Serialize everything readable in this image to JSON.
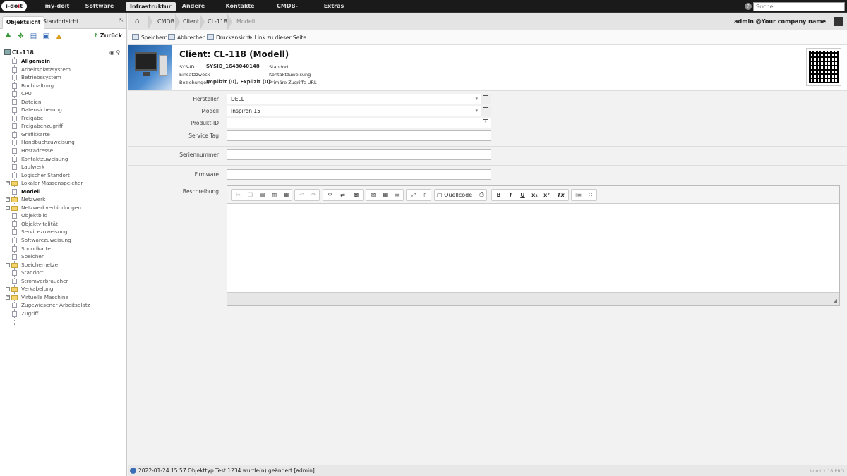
{
  "logo": {
    "text_a": "i-do",
    "text_b": "i",
    "text_c": "t"
  },
  "nav": [
    "my-doit",
    "Software",
    "Infrastruktur",
    "Andere",
    "Kontakte",
    "CMDB-Explorer",
    "Extras"
  ],
  "search": {
    "placeholder": "Suche..."
  },
  "left": {
    "tabs": [
      "Objektsicht",
      "Standortsicht"
    ],
    "back_label": "Zurück",
    "root": "CL-118",
    "tree": [
      {
        "label": "Allgemein",
        "bold": true,
        "type": "doc"
      },
      {
        "label": "Arbeitsplatzsystem",
        "type": "doc"
      },
      {
        "label": "Betriebssystem",
        "type": "doc"
      },
      {
        "label": "Buchhaltung",
        "type": "doc"
      },
      {
        "label": "CPU",
        "type": "doc"
      },
      {
        "label": "Dateien",
        "type": "doc"
      },
      {
        "label": "Datensicherung",
        "type": "doc"
      },
      {
        "label": "Freigabe",
        "type": "doc"
      },
      {
        "label": "Freigabenzugriff",
        "type": "doc"
      },
      {
        "label": "Grafikkarte",
        "type": "doc"
      },
      {
        "label": "Handbuchzuweisung",
        "type": "doc"
      },
      {
        "label": "Hostadresse",
        "type": "doc"
      },
      {
        "label": "Kontaktzuweisung",
        "type": "doc"
      },
      {
        "label": "Laufwerk",
        "type": "doc"
      },
      {
        "label": "Logischer Standort",
        "type": "doc"
      },
      {
        "label": "Lokaler Massenspeicher",
        "type": "folder"
      },
      {
        "label": "Modell",
        "bold": true,
        "type": "doc"
      },
      {
        "label": "Netzwerk",
        "type": "folder"
      },
      {
        "label": "Netzwerkverbindungen",
        "type": "folder"
      },
      {
        "label": "Objektbild",
        "type": "doc"
      },
      {
        "label": "Objektvitalität",
        "type": "doc"
      },
      {
        "label": "Servicezuweisung",
        "type": "doc"
      },
      {
        "label": "Softwarezuweisung",
        "type": "doc"
      },
      {
        "label": "Soundkarte",
        "type": "doc"
      },
      {
        "label": "Speicher",
        "type": "doc"
      },
      {
        "label": "Speichernetze",
        "type": "folder"
      },
      {
        "label": "Standort",
        "type": "doc"
      },
      {
        "label": "Stromverbraucher",
        "type": "doc"
      },
      {
        "label": "Verkabelung",
        "type": "folder"
      },
      {
        "label": "Virtuelle Maschine",
        "type": "folder"
      },
      {
        "label": "Zugewiesener Arbeitsplatz",
        "type": "doc"
      },
      {
        "label": "Zugriff",
        "type": "doc"
      }
    ]
  },
  "breadcrumb": [
    "CMDB",
    "Client",
    "CL-118",
    "Modell"
  ],
  "user": "admin  @Your company name",
  "actions": [
    "Speichern",
    "Abbrechen",
    "Druckansicht",
    "Link zu dieser Seite"
  ],
  "header": {
    "title": "Client: CL-118 (Modell)",
    "sysid_label": "SYS-ID",
    "sysid_value": "SYSID_1643040148",
    "purpose_label": "Einsatzzweck",
    "relations_label": "Beziehungen",
    "relations_value": "Implizit (0), Explizit (0)",
    "location_label": "Standort",
    "contact_label": "Kontaktzuweisung",
    "url_label": "Primäre Zugriffs-URL",
    "url_value": "-"
  },
  "form": {
    "hersteller_label": "Hersteller",
    "hersteller_value": "DELL",
    "modell_label": "Modell",
    "modell_value": "Inspiron 15",
    "produktid_label": "Produkt-ID",
    "produktid_value": "",
    "servicetag_label": "Service Tag",
    "servicetag_value": "",
    "serial_label": "Seriennummer",
    "serial_value": "",
    "firmware_label": "Firmware",
    "firmware_value": "",
    "desc_label": "Beschreibung",
    "source_label": "Quellcode"
  },
  "status": {
    "text": "2022-01-24 15:57 Objekttyp Test 1234 wurde(n) geändert [admin]",
    "version": "i-doit 1.18 PRO"
  }
}
